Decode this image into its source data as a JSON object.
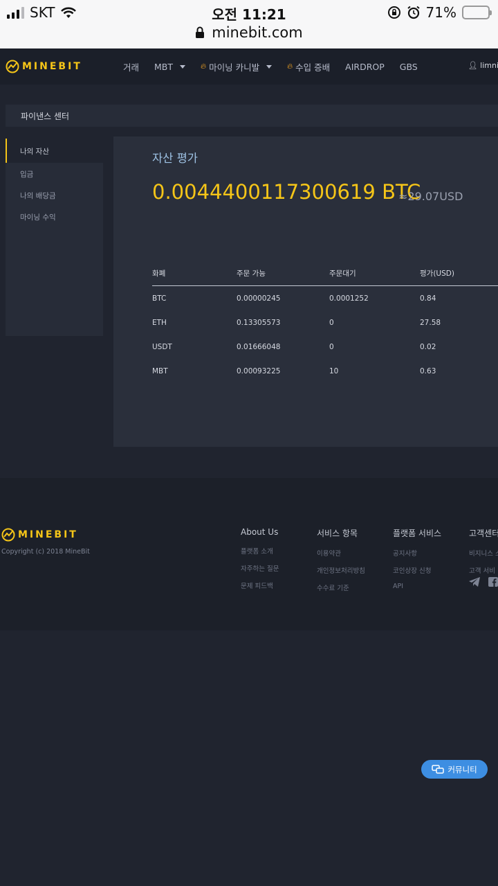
{
  "status_bar": {
    "carrier": "SKT",
    "time": "오전 11:21",
    "battery_percent": "71%",
    "battery_level": 0.71,
    "url": "minebit.com"
  },
  "brand": {
    "logo_text": "MINEBIT",
    "accent_color": "#f5c518"
  },
  "nav": {
    "items": [
      "거래",
      "MBT",
      "마이닝 카니발",
      "수입 증배",
      "AIRDROP",
      "GBS"
    ],
    "user": "limnin"
  },
  "breadcrumb": "파이낸스 센터",
  "sidebar": {
    "items": [
      "나의 자산",
      "입금",
      "나의 배당금",
      "마이닝 수익"
    ],
    "active_index": 0
  },
  "assets": {
    "title": "자산 평가",
    "total_btc": "0.0044400117300619 BTC",
    "total_usd": "≈29.07USD"
  },
  "table": {
    "headers": [
      "화폐",
      "주문 가능",
      "주문대기",
      "평가(USD)"
    ],
    "rows": [
      [
        "BTC",
        "0.00000245",
        "0.0001252",
        "0.84"
      ],
      [
        "ETH",
        "0.13305573",
        "0",
        "27.58"
      ],
      [
        "USDT",
        "0.01666048",
        "0",
        "0.02"
      ],
      [
        "MBT",
        "0.00093225",
        "10",
        "0.63"
      ]
    ]
  },
  "footer": {
    "copyright": "Copyright (c) 2018 MineBit",
    "columns": [
      {
        "title": "About Us",
        "links": [
          "플랫폼 소개",
          "자주하는 질문",
          "문제 피드백"
        ]
      },
      {
        "title": "서비스 항목",
        "links": [
          "이용약관",
          "개인정보처리방침",
          "수수료 기준"
        ]
      },
      {
        "title": "플랫폼 서비스",
        "links": [
          "공지사항",
          "코인상장 신청",
          "API"
        ]
      },
      {
        "title": "고객센터",
        "links": [
          "비지니스 소",
          "고객 서비"
        ]
      }
    ]
  },
  "community_button": "커뮤니티"
}
